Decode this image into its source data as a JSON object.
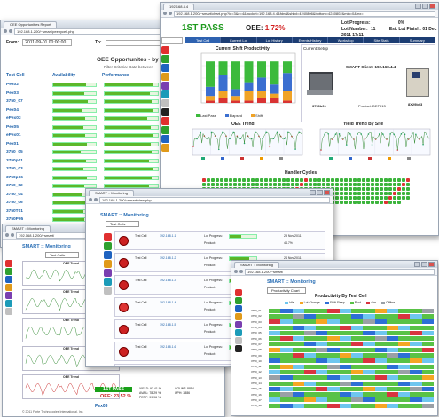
{
  "win1": {
    "tab": "OEE Opportunities Report",
    "url": "192.168.1.200/~smart/peebycell.php",
    "from_label": "From:",
    "from_value": "2011-09-01 00:00:00",
    "to_label": "To:",
    "title": "OEE Opportunites - by T",
    "subtitle": "Filter Criteria: Data between",
    "col_cell": "Test Cell",
    "col_avail": "Availability",
    "col_perf": "Performance",
    "cells": [
      "Pex02",
      "Pex03",
      "3750_07",
      "Pex04",
      "ePex03",
      "Pex05",
      "ePex01",
      "Pex01",
      "3750_05",
      "3750p01",
      "3750_03",
      "3750p16",
      "3750_02",
      "3750_04",
      "3750_06",
      "3750T01",
      "3750P05"
    ]
  },
  "win2": {
    "tab": "192.168.4.4",
    "url": "192.168.1.200/~smart/chart.php?id=3&e=4&bucket=192.168.4.4&fdnd&shbd=4240806&bottom=4240802&min=0&mx=",
    "pass_label": "1ST PASS",
    "oee_label": "OEE:",
    "oee_value": "1.72%",
    "lot_progress_label": "Lot Progress:",
    "lot_progress_value": "0%",
    "lot_number_label": "Lot Number:",
    "lot_number_value": "11",
    "est_finish_label": "Est. Lot Finish:",
    "est_finish_value": "01 Dec 2011 17:11",
    "menu": [
      "Test Cell",
      "Current Lot",
      "Lot History",
      "Events History",
      "Workshop",
      "Site Stats",
      "Summary"
    ],
    "shift_chart_title": "Current Shift Productivity",
    "current_setup": "Current Setup",
    "client_label": "SMART Client: 192.168.4.4",
    "product_label": "Product: DEF913",
    "legend_items": [
      "Last Pass",
      "Elapsed",
      "Shift"
    ],
    "oee_trend_title": "OEE Trend",
    "yield_trend_title": "Yield Trend By Site",
    "handler_title": "Handler Cycles",
    "device_left": "3750b01",
    "device_right": "8X29b03",
    "shift_bars": [
      {
        "green": 0.55,
        "blue": 0.2,
        "orange": 0.1,
        "red": 0.05
      },
      {
        "green": 0.3,
        "blue": 0.35,
        "orange": 0.15,
        "red": 0.1
      },
      {
        "green": 0.6,
        "blue": 0.15,
        "orange": 0.1,
        "red": 0.05
      },
      {
        "green": 0.45,
        "blue": 0.2,
        "orange": 0.2,
        "red": 0.05
      },
      {
        "green": 0.35,
        "blue": 0.3,
        "orange": 0.15,
        "red": 0.1
      },
      {
        "green": 0.5,
        "blue": 0.2,
        "orange": 0.1,
        "red": 0.1
      },
      {
        "green": 0.25,
        "blue": 0.4,
        "orange": 0.2,
        "red": 0.05
      }
    ]
  },
  "win3": {
    "tab": "SMART :: Monitoring",
    "url": "192.168.1.200/~smart/view.php",
    "title": "SMART :: Monitoring",
    "filter": "Test Cells",
    "rows": [
      {
        "cell": "Test Cell",
        "addr": "192.168.1.1",
        "lot": "Lot Progress:",
        "prod": "Product:",
        "time": "23 Nov 2011",
        "val": "44.7%"
      },
      {
        "cell": "Test Cell",
        "addr": "192.168.1.2",
        "lot": "Lot Progress:",
        "prod": "Product:",
        "time": "24 Nov 2011",
        "val": "72.0%"
      },
      {
        "cell": "Test Cell",
        "addr": "192.168.1.3",
        "lot": "Lot Progress:",
        "prod": "Product:",
        "time": "24 Nov 2011",
        "val": "30.1%"
      },
      {
        "cell": "Test Cell",
        "addr": "192.168.1.4",
        "lot": "Lot Progress:",
        "prod": "Product:",
        "time": "22 Nov 2011",
        "val": "65.3%"
      },
      {
        "cell": "Test Cell",
        "addr": "192.168.1.5",
        "lot": "Lot Progress:",
        "prod": "Product:",
        "time": "23 Nov 2011",
        "val": "12.8%"
      },
      {
        "cell": "Test Cell",
        "addr": "192.168.1.6",
        "lot": "Lot Progress:",
        "prod": "Product:",
        "time": "25 Nov 2011",
        "val": "88.4%"
      },
      {
        "cell": "Test Cell",
        "addr": "192.168.1.7",
        "lot": "Lot Progress:",
        "prod": "Product:",
        "time": "24 Nov 2011",
        "val": "51.0%"
      }
    ]
  },
  "win4": {
    "tab": "SMART :: Monitoring",
    "url": "192.168.1.200/~smart/",
    "title": "SMART :: Monitoring",
    "filter": "Test Cells",
    "panels": [
      "OEE Trend",
      "OEE Trend",
      "OEE Trend",
      "OEE Trend",
      "OEE Trend"
    ],
    "pass": "1ST PASS",
    "oee_line": "OEE: 23.52 %",
    "yield": "YIELD: 93.41 %",
    "avail": "AVAIL: 78.29 %",
    "perf": "PERF: 99.96 %",
    "count": "COUNT: 8854",
    "uph": "UPH: 3886",
    "cell": "Pex03",
    "footer": "© 2011 Forte Technologies International, Inc."
  },
  "win5": {
    "tab": "SMART :: Monitoring",
    "url": "192.168.1.200/~smart/",
    "title": "SMART :: Monitoring",
    "filter": "Productivity Chart",
    "chart_title": "Productivity By Test Cell",
    "legend": [
      "Idle",
      "Lot Change",
      "Shift Sleep",
      "Prod",
      "Alm",
      "Offline"
    ],
    "cells": [
      "3750_01",
      "3750_02",
      "3750_03",
      "3750_04",
      "3750_05",
      "3750_06",
      "3750_07",
      "3750_08",
      "3750_09",
      "3750_10",
      "3750_11",
      "3750_12",
      "3750_13",
      "3750_14",
      "3750_15",
      "3750_16",
      "3750_17",
      "3750_18"
    ]
  }
}
